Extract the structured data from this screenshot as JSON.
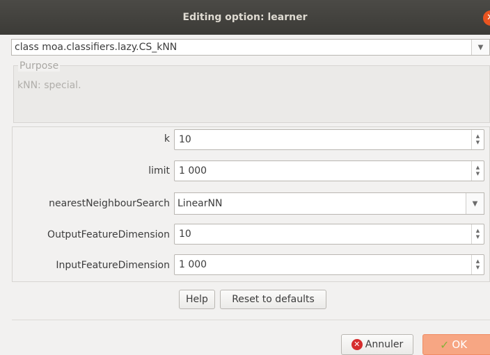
{
  "window": {
    "title": "Editing option: learner"
  },
  "classSelector": {
    "value": "class moa.classifiers.lazy.CS_kNN"
  },
  "purpose": {
    "legend": "Purpose",
    "text": "kNN: special."
  },
  "options": [
    {
      "label": "k",
      "value": "10",
      "kind": "spinner"
    },
    {
      "label": "limit",
      "value": "1 000",
      "kind": "spinner"
    },
    {
      "label": "nearestNeighbourSearch",
      "value": "LinearNN",
      "kind": "dropdown"
    },
    {
      "label": "OutputFeatureDimension",
      "value": "10",
      "kind": "spinner"
    },
    {
      "label": "InputFeatureDimension",
      "value": "1 000",
      "kind": "spinner"
    }
  ],
  "buttons": {
    "help": "Help",
    "reset": "Reset to defaults",
    "cancel": "Annuler",
    "ok": "OK"
  },
  "colors": {
    "accent": "#e95420",
    "okButton": "#f7a683",
    "titlebar": "#3c3b37"
  }
}
